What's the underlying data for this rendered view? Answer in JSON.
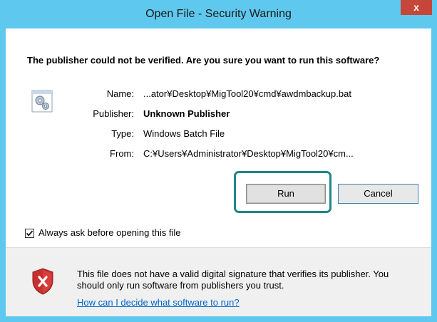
{
  "window": {
    "title": "Open File - Security Warning",
    "close_label": "x"
  },
  "dialog": {
    "headline": "The publisher could not be verified.  Are you sure you want to run this software?",
    "fields": {
      "name_label": "Name:",
      "name_value": "...ator¥Desktop¥MigTool20¥cmd¥awdmbackup.bat",
      "publisher_label": "Publisher:",
      "publisher_value": "Unknown Publisher",
      "type_label": "Type:",
      "type_value": "Windows Batch File",
      "from_label": "From:",
      "from_value": "C:¥Users¥Administrator¥Desktop¥MigTool20¥cm..."
    },
    "buttons": {
      "run_label": "Run",
      "cancel_label": "Cancel"
    },
    "checkbox": {
      "label": "Always ask before opening this file",
      "checked": true
    },
    "warning": {
      "text": "This file does not have a valid digital signature that verifies its publisher.  You should only run software from publishers you trust.",
      "link_text": "How can I decide what software to run?"
    }
  },
  "colors": {
    "title_bar": "#5fc8ef",
    "close_button": "#c7463a",
    "highlight": "#1e8589",
    "link": "#0066cc",
    "bottom_panel": "#f0f0f0"
  },
  "icons": {
    "file": "gear-file-icon",
    "shield": "shield-error-icon",
    "check": "check-icon"
  }
}
